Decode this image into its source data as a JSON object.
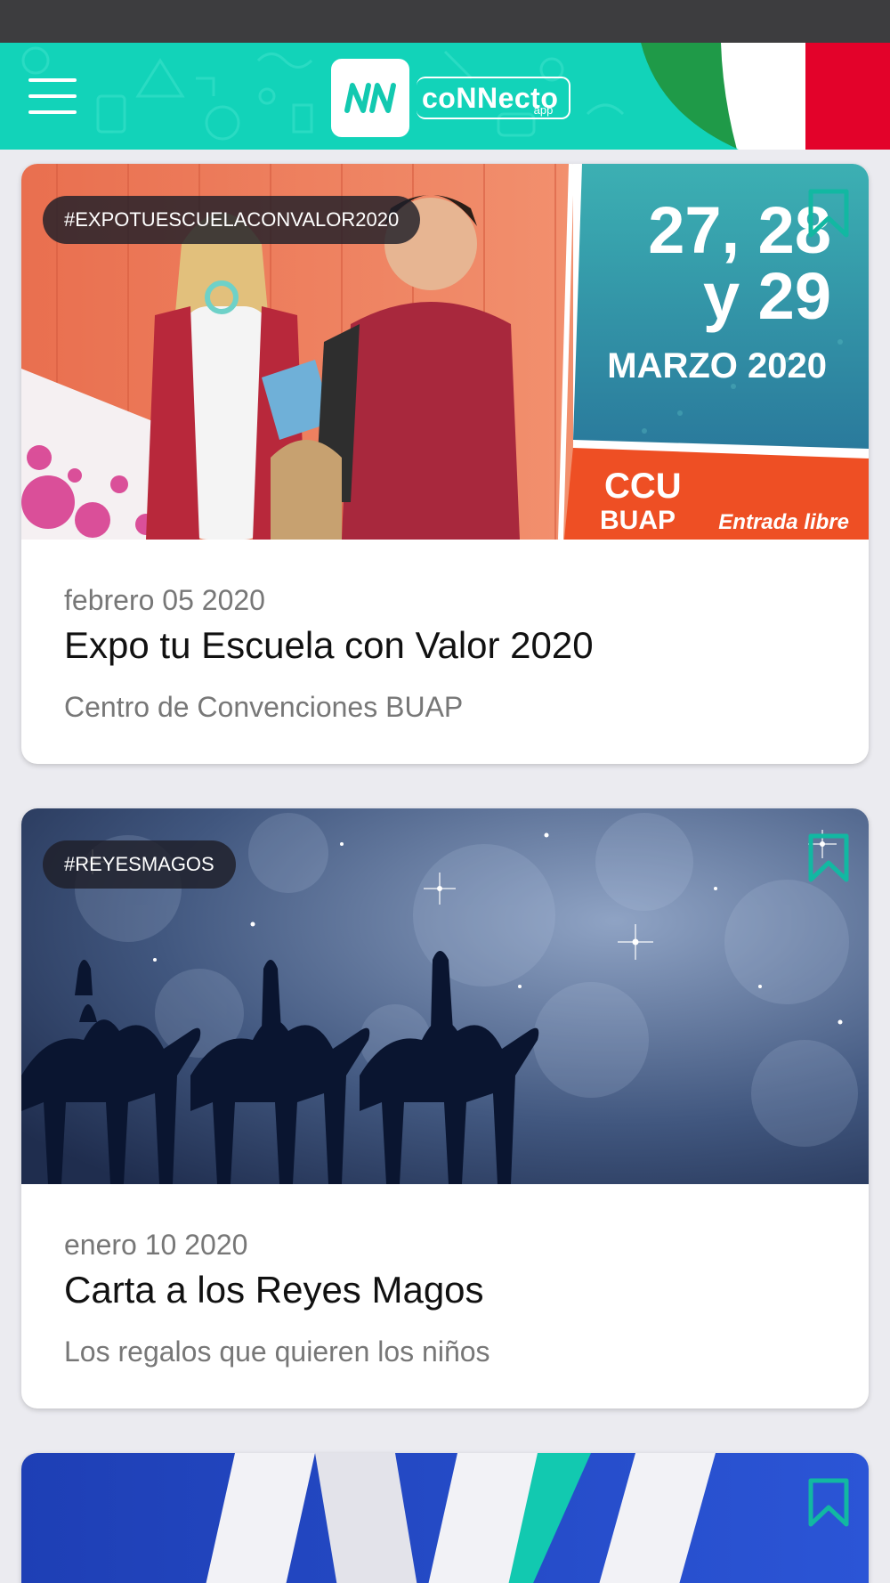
{
  "header": {
    "brand_name": "coNNecto",
    "brand_sub": "app",
    "logo_mark": "NN",
    "menu_icon": "hamburger-menu-icon",
    "colors": {
      "header_bg": "#12d3b9",
      "flag_green": "#1f9a48",
      "flag_white": "#ffffff",
      "flag_red": "#e3022a"
    }
  },
  "feed": {
    "cards": [
      {
        "tag": "#EXPOTUESCUELACONVALOR2020",
        "date": "febrero 05 2020",
        "title": "Expo tu Escuela con Valor 2020",
        "subtitle": "Centro de Convenciones BUAP",
        "image": {
          "dates_line1": "27, 28",
          "dates_line2": "y 29",
          "month": "MARZO 2020",
          "venue_line1": "CCU",
          "venue_line2": "BUAP",
          "entry": "Entrada libre"
        },
        "bookmark_icon": "bookmark-outline-icon"
      },
      {
        "tag": "#REYESMAGOS",
        "date": "enero 10 2020",
        "title": "Carta a los Reyes Magos",
        "subtitle": "Los regalos que quieren los niños",
        "bookmark_icon": "bookmark-outline-icon"
      },
      {
        "bookmark_icon": "bookmark-outline-icon"
      }
    ]
  },
  "colors": {
    "accent": "#12b8a2",
    "page_bg": "#ebebf0",
    "status_bar": "#3d3d3f"
  }
}
